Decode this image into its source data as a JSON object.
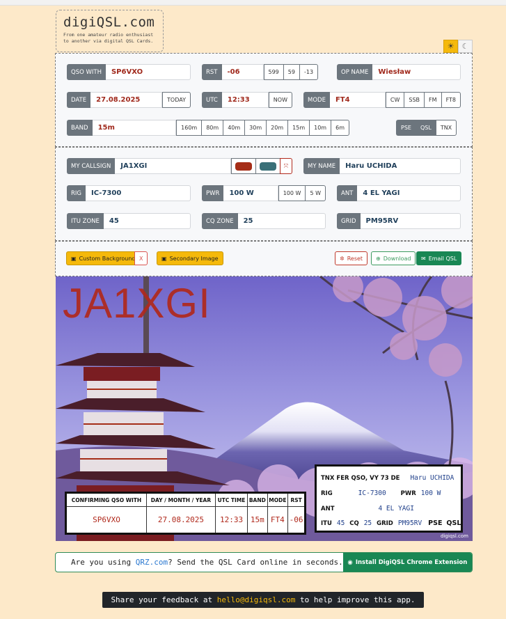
{
  "logo": {
    "title": "digiQSL.com",
    "subtitle_line1": "From one amateur radio enthusiast",
    "subtitle_line2": "to another via digital QSL Cards."
  },
  "theme": {
    "light_icon": "sun-icon",
    "dark_icon": "moon-icon"
  },
  "qso": {
    "qso_with_label": "QSO WITH",
    "qso_with": "SP6VXO",
    "rst_label": "RST",
    "rst": "-06",
    "rst_presets": [
      "599",
      "59",
      "-13"
    ],
    "op_name_label": "OP NAME",
    "op_name": "Wiesław",
    "date_label": "DATE",
    "date": "27.08.2025",
    "today": "TODAY",
    "utc_label": "UTC",
    "utc": "12:33",
    "now": "NOW",
    "mode_label": "MODE",
    "mode": "FT4",
    "modes": [
      "CW",
      "SSB",
      "FM",
      "FT8"
    ],
    "band_label": "BAND",
    "band": "15m",
    "bands": [
      "160m",
      "80m",
      "40m",
      "30m",
      "20m",
      "15m",
      "10m",
      "6m"
    ],
    "pse_tnx": [
      "PSE",
      "QSL",
      "TNX"
    ]
  },
  "station": {
    "callsign_label": "MY CALLSIGN",
    "callsign": "JA1XGI",
    "colors": [
      "#a52d17",
      "#3a7078"
    ],
    "name_label": "MY NAME",
    "name": "Haru UCHIDA",
    "rig_label": "RIG",
    "rig": "IC-7300",
    "pwr_label": "PWR",
    "pwr": "100 W",
    "pwr_presets": [
      "100 W",
      "5 W"
    ],
    "ant_label": "ANT",
    "ant": "4 EL YAGI",
    "itu_label": "ITU ZONE",
    "itu": "45",
    "cq_label": "CQ ZONE",
    "cq": "25",
    "grid_label": "GRID",
    "grid": "PM95RV"
  },
  "actions": {
    "custom_bg": "Custom Background",
    "custom_bg_clear": "X",
    "secondary": "Secondary Image",
    "reset": "Reset",
    "download": "Download",
    "email": "Email QSL"
  },
  "card": {
    "callsign": "JA1XGI",
    "table_headers": [
      "CONFIRMING QSO WITH",
      "DAY / MONTH / YEAR",
      "UTC TIME",
      "BAND",
      "MODE",
      "RST"
    ],
    "table_values": [
      "SP6VXO",
      "27.08.2025",
      "12:33",
      "15m",
      "FT4",
      "-06"
    ],
    "tnx_label": "TNX FER QSO, VY 73 DE",
    "tnx_name": "Haru UCHIDA",
    "rig_label": "RIG",
    "rig": "IC-7300",
    "pwr_label": "PWR",
    "pwr": "100 W",
    "ant_label": "ANT",
    "ant": "4 EL YAGI",
    "itu_label": "ITU",
    "itu": "45",
    "cq_label": "CQ",
    "cq": "25",
    "grid_label": "GRID",
    "grid": "PM95RV",
    "pse_label": "PSE",
    "qsl_label": "QSL",
    "watermark": "digiqsl.com"
  },
  "qrz": {
    "prefix": "Are you using ",
    "link": "QRZ.com",
    "suffix": "? Send the QSL Card online in seconds.",
    "extension": "Install DigiQSL Chrome Extension"
  },
  "feedback": {
    "prefix": "Share your feedback at ",
    "email": "hello@digiqsl.com",
    "suffix": " to help improve this app."
  }
}
